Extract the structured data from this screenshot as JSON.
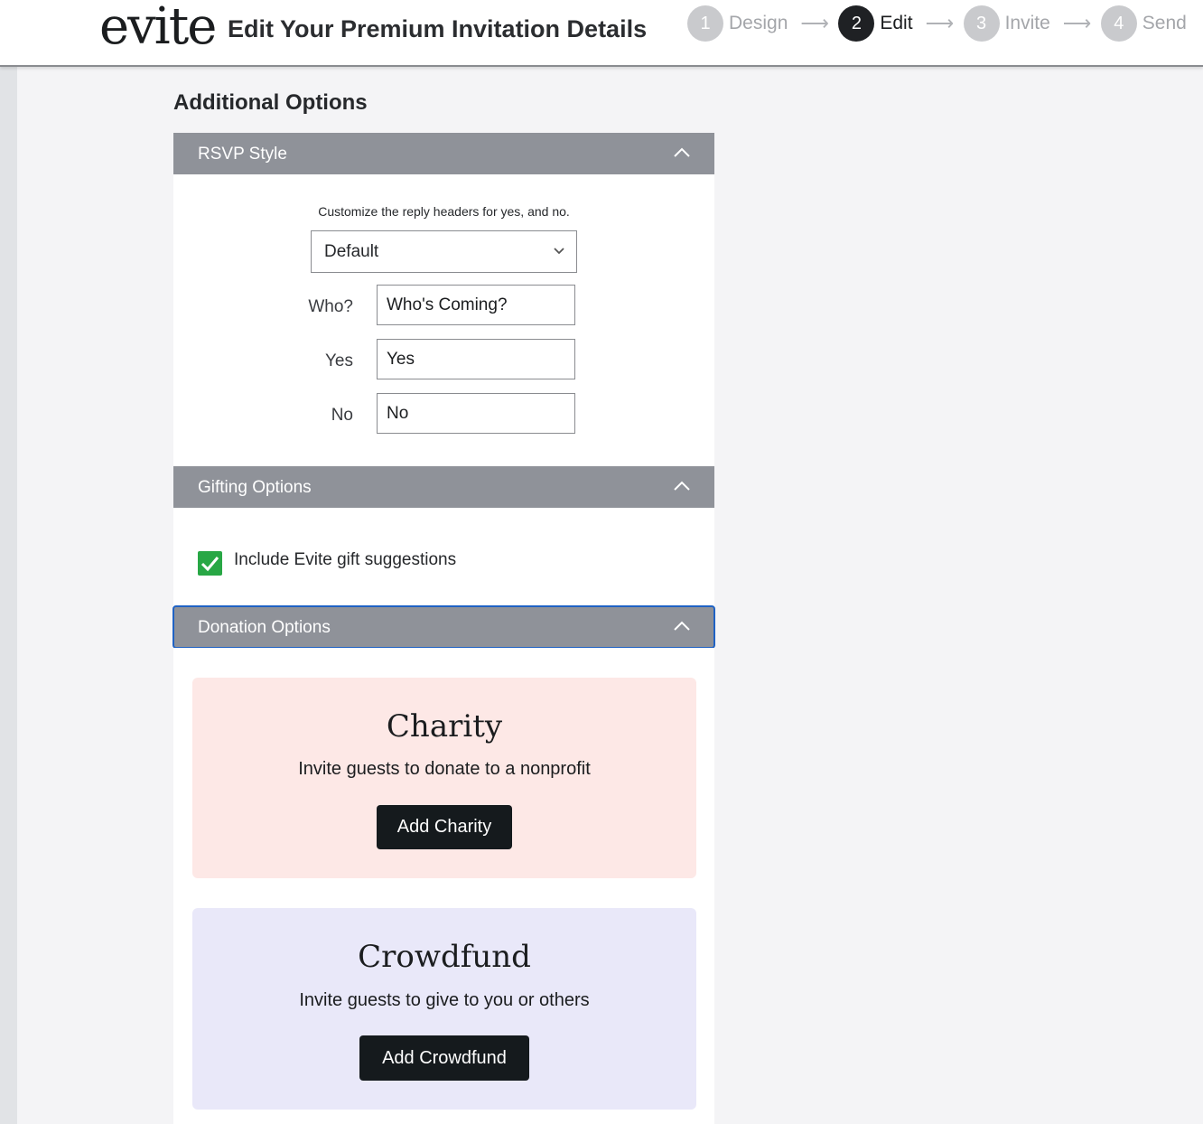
{
  "header": {
    "logo": "evite",
    "title": "Edit Your Premium Invitation Details",
    "steps": [
      {
        "number": "1",
        "label": "Design"
      },
      {
        "number": "2",
        "label": "Edit"
      },
      {
        "number": "3",
        "label": "Invite"
      },
      {
        "number": "4",
        "label": "Send"
      }
    ],
    "active_step": "Edit"
  },
  "main": {
    "heading": "Additional Options",
    "rsvp": {
      "title": "RSVP Style",
      "description": "Customize the reply headers for yes, and no.",
      "style_select": "Default",
      "who_label": "Who?",
      "who_value": "Who's Coming?",
      "yes_label": "Yes",
      "yes_value": "Yes",
      "no_label": "No",
      "no_value": "No"
    },
    "gifting": {
      "title": "Gifting Options",
      "checkbox_label": "Include Evite gift suggestions",
      "checked": true
    },
    "donation": {
      "title": "Donation Options",
      "charity": {
        "title": "Charity",
        "subtitle": "Invite guests to donate to a nonprofit",
        "button": "Add Charity"
      },
      "crowdfund": {
        "title": "Crowdfund",
        "subtitle": "Invite guests to give to you or others",
        "button": "Add Crowdfund"
      }
    }
  },
  "colors": {
    "panel_header": "#8f9299",
    "accent_check": "#28a745",
    "charity_bg": "#fde8e6",
    "crowdfund_bg": "#e9e8f9",
    "button_dark": "#151a1d",
    "focus_outline": "#1f62c4"
  }
}
